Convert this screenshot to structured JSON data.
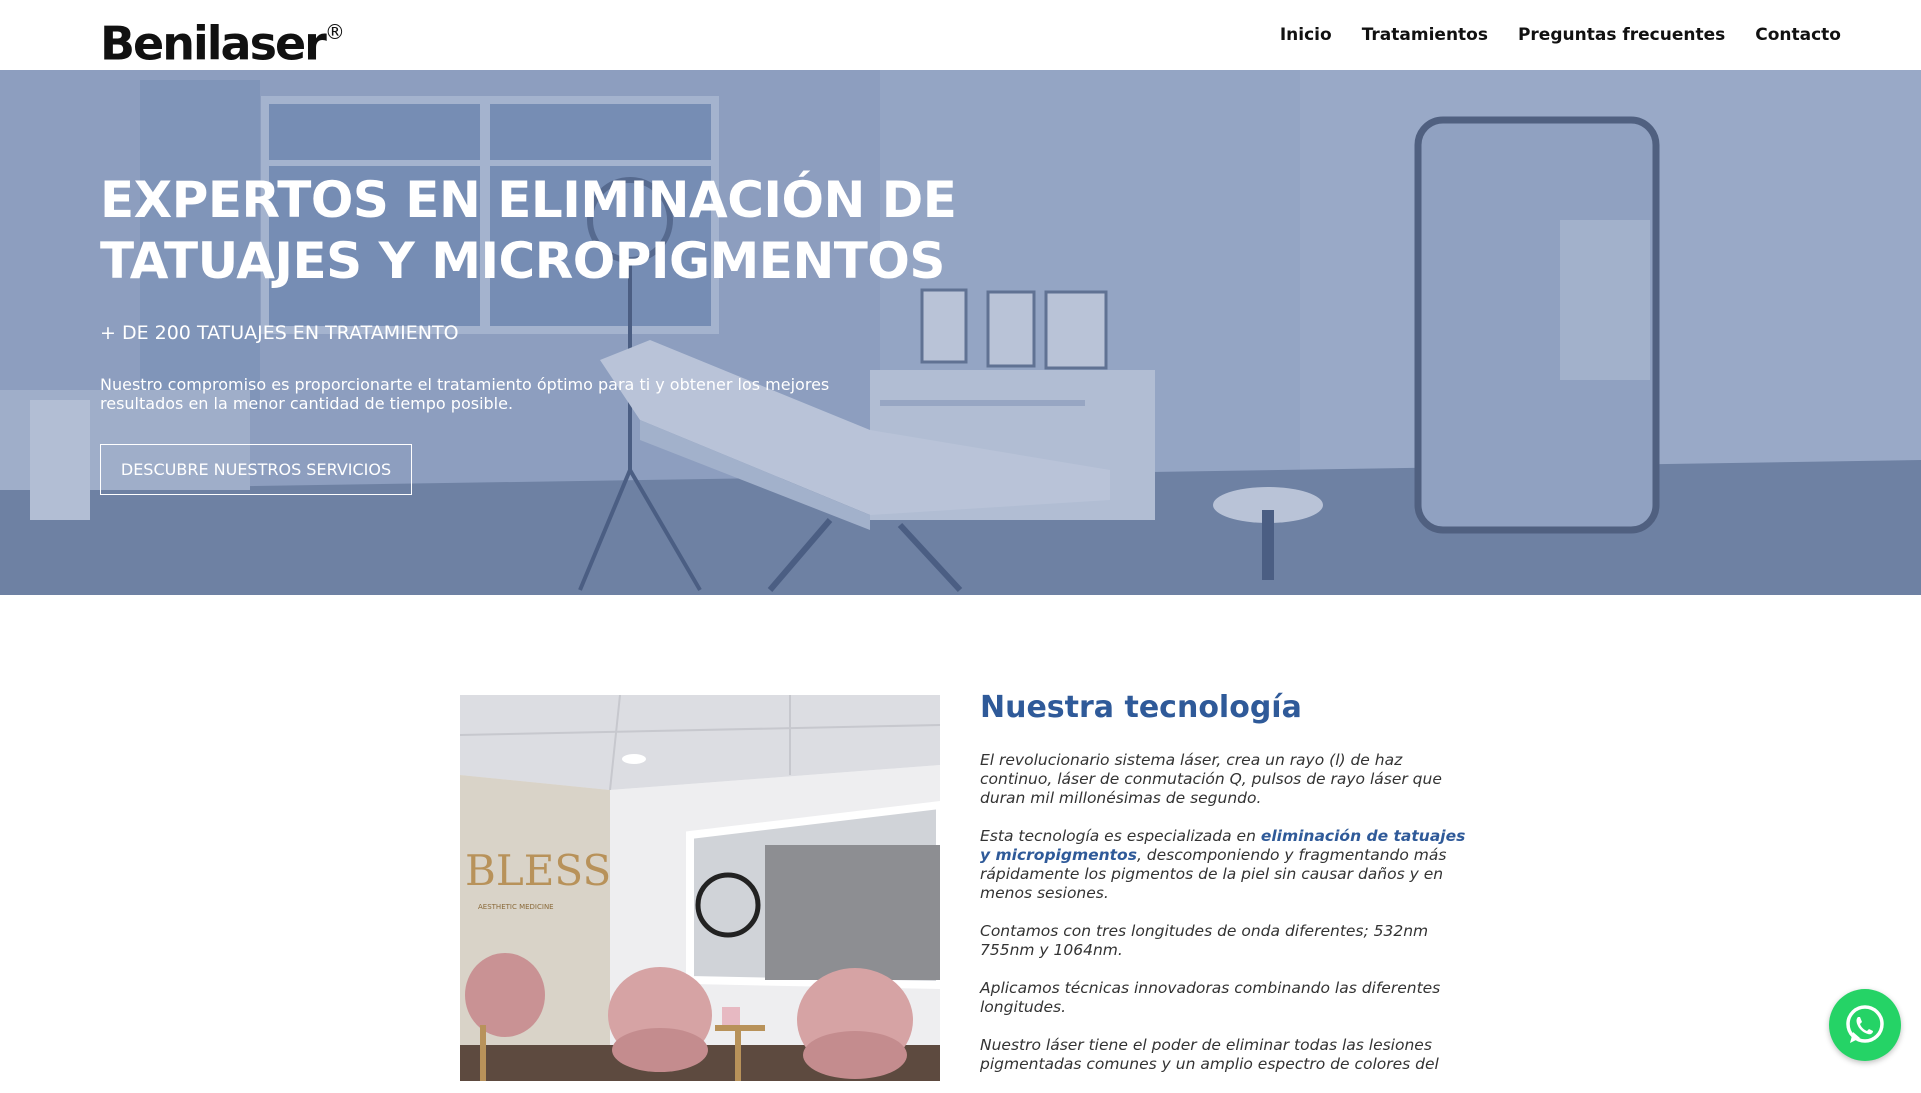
{
  "brand": {
    "name": "Benilaser",
    "mark": "®"
  },
  "nav": {
    "items": [
      {
        "label": "Inicio"
      },
      {
        "label": "Tratamientos"
      },
      {
        "label": "Preguntas frecuentes"
      },
      {
        "label": "Contacto"
      }
    ]
  },
  "hero": {
    "title_line1": "EXPERTOS EN ELIMINACIÓN DE",
    "title_line2": "TATUAJES Y MICROPIGMENTOS",
    "subtitle": "+ DE 200 TATUAJES EN TRATAMIENTO",
    "text": "Nuestro compromiso es proporcionarte el tratamiento óptimo para ti y obtener los mejores resultados en la menor cantidad de tiempo posible.",
    "button_label": "DESCUBRE NUESTROS SERVICIOS"
  },
  "tech": {
    "heading": "Nuestra tecnología",
    "p1": "El revolucionario sistema láser, crea un rayo (l) de haz continuo, láser de conmutación Q, pulsos de rayo láser que duran mil millonésimas de segundo.",
    "p2_before": "Esta tecnología es especializada en ",
    "p2_highlight": "eliminación de tatuajes y micropigmentos",
    "p2_after": ", descomponiendo y fragmentando más rápidamente los pigmentos de la piel sin causar daños y en menos sesiones.",
    "p3": "Contamos con tres longitudes de onda diferentes; 532nm 755nm y 1064nm.",
    "p4": "Aplicamos técnicas innovadoras combinando las diferentes longitudes.",
    "p5": "Nuestro láser tiene el poder de eliminar todas las lesiones pigmentadas comunes y un amplio espectro de colores del"
  },
  "photo": {
    "sign_text": "BLESS",
    "sign_sub": "AESTHETIC MEDICINE"
  },
  "colors": {
    "accent": "#2f5a99",
    "whatsapp": "#25d366"
  },
  "icons": {
    "whatsapp": "whatsapp-icon",
    "logo": "benilaser-logo"
  }
}
